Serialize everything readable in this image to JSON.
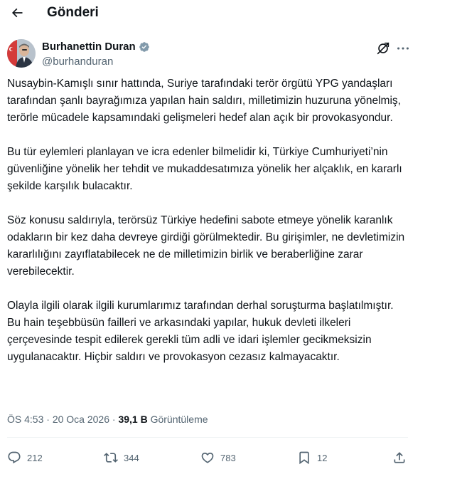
{
  "header": {
    "title": "Gönderi"
  },
  "author": {
    "name": "Burhanettin Duran",
    "handle": "@burhanduran"
  },
  "tweet": {
    "paragraphs": [
      "Nusaybin-Kamışlı sınır hattında, Suriye tarafındaki terör örgütü YPG yandaşları tarafından şanlı bayrağımıza yapılan hain saldırı, milletimizin huzuruna yönelmiş, terörle mücadele kapsamındaki gelişmeleri hedef alan açık bir provokasyondur.",
      "Bu tür eylemleri planlayan ve icra edenler bilmelidir ki, Türkiye Cumhuriyeti’nin güvenliğine yönelik her tehdit ve mukaddesatımıza yönelik her alçaklık, en kararlı şekilde karşılık bulacaktır.",
      "Söz konusu saldırıyla, terörsüz Türkiye hedefini sabote etmeye yönelik karanlık odakların bir kez daha devreye girdiği görülmektedir. Bu girişimler, ne devletimizin kararlılığını zayıflatabilecek ne de milletimizin birlik ve beraberliğine zarar verebilecektir.",
      "Olayla ilgili olarak ilgili kurumlarımız tarafından derhal soruşturma başlatılmıştır. Bu hain teşebbüsün failleri ve arkasındaki yapılar, hukuk devleti ilkeleri çerçevesinde tespit edilerek gerekli tüm adli ve idari işlemler gecikmeksizin uygulanacaktır. Hiçbir saldırı ve provokasyon cezasız kalmayacaktır."
    ],
    "time": "ÖS 4:53",
    "separator": "·",
    "date": "20 Oca 2026",
    "views_count": "39,1 B",
    "views_label": "Görüntüleme"
  },
  "actions": {
    "replies": "212",
    "reposts": "344",
    "likes": "783",
    "bookmarks": "12"
  },
  "colors": {
    "text": "#0f1419",
    "secondary": "#536471",
    "verified": "#829aab",
    "divider": "#eff3f4"
  }
}
